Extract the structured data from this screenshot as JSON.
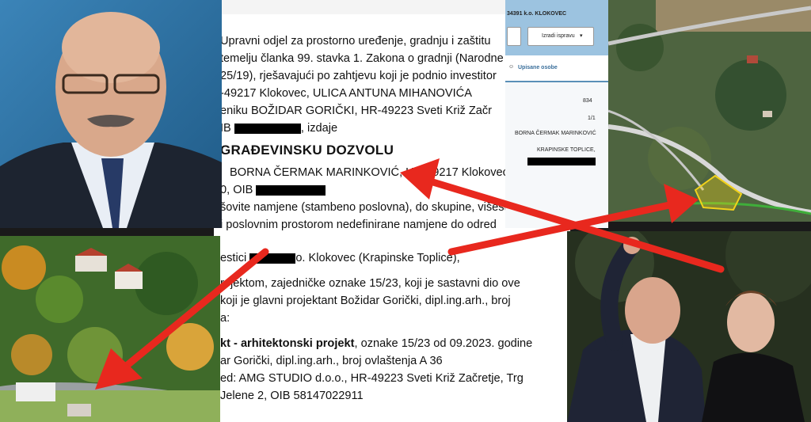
{
  "document": {
    "lines": [
      {
        "text": "Upravni odjel za prostorno uređenje, gradnju i zaštitu"
      },
      {
        "text": "temelju članka 99. stavka 1. Zakona o gradnji (Narodne"
      },
      {
        "text": "25/19), rješavajući po zahtjevu koji je podnio investitor"
      },
      {
        "text": "-49217 Klokovec, ULICA ANTUNA MIHANOVIĆA"
      },
      {
        "text": "eniku BOŽIDAR GORIČKI, HR-49223 Sveti Križ Začr"
      },
      {
        "text_a": "IB",
        "text_b": ", izdaje"
      },
      {
        "text": "GRAĐEVINSKU DOZVOLU"
      },
      {
        "text": "BORNA ČERMAK MARINKOVIĆ, HR-49217 Klokovec"
      },
      {
        "text_a": "0, OIB"
      },
      {
        "text": "šovite namjene (stambeno poslovna), do skupine, višest"
      },
      {
        "text": "i poslovnim prostorom nedefinirane namjene do odred"
      },
      {
        "text_a": "estici",
        "text_b": "o. Klokovec (Krapinske Toplice),"
      },
      {
        "text": "rojektom, zajedničke oznake 15/23, koji je sastavni dio ove"
      },
      {
        "text": "koji je glavni projektant Božidar Gorički, dipl.ing.arh., broj"
      },
      {
        "text": "a:"
      },
      {
        "text_bold": "kt - arhitektonski projekt",
        "text": ", oznake 15/23 od 09.2023. godine"
      },
      {
        "text": "ar Gorički, dipl.ing.arh., broj ovlaštenja A 36"
      },
      {
        "text": "ed: AMG STUDIO d.o.o., HR-49223 Sveti Križ Začretje, Trg"
      },
      {
        "text": "Jelene 2, OIB 58147022911"
      }
    ]
  },
  "cadastre": {
    "title": "34391 k.o. KLOKOVEC",
    "button_label": "Izradi ispravu",
    "tab_label": "Upisane osobe",
    "value_1": "834",
    "value_2": "1/1",
    "owner_name": "BORNA ČERMAK MARINKOVIĆ",
    "owner_place": "KRAPINSKE TOPLICE,"
  },
  "colors": {
    "arrow": "#e8281e",
    "parcel": "#f2d21b"
  }
}
